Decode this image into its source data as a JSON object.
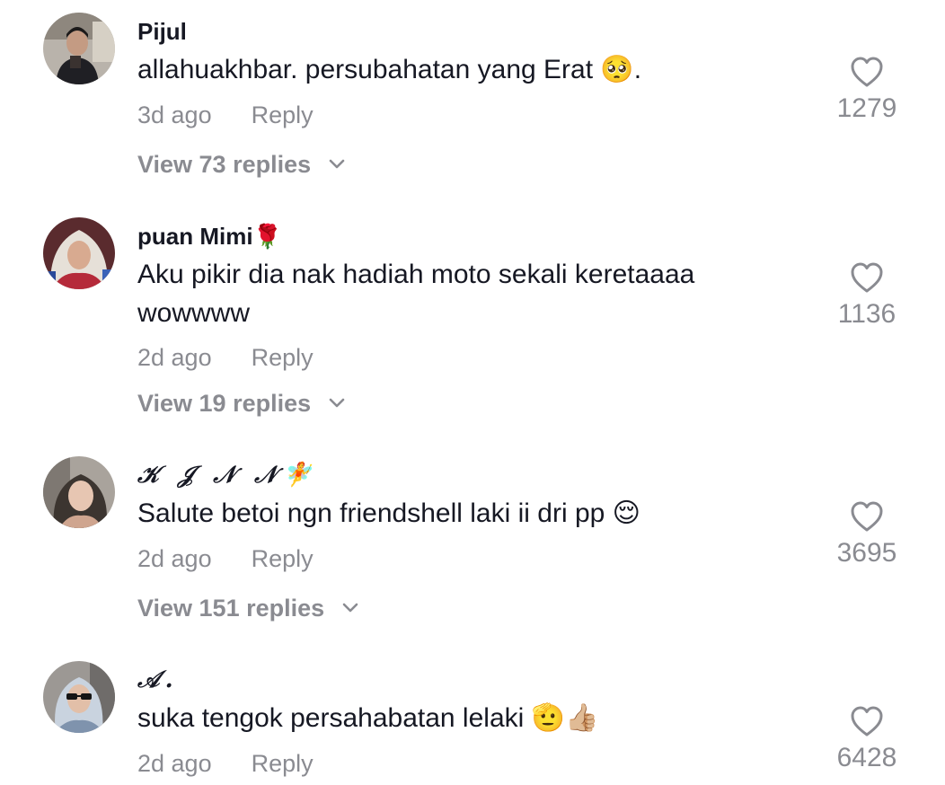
{
  "comments": [
    {
      "username": "Pijul",
      "username_emoji": "",
      "text": "allahuakhbar. persubahatan yang Erat 🥺.",
      "time": "3d ago",
      "reply_label": "Reply",
      "view_replies": "View 73 replies",
      "likes": "1279"
    },
    {
      "username": "puan Mimi",
      "username_emoji": "🌹",
      "text": "Aku pikir dia nak hadiah moto sekali keretaaaa wowwww",
      "time": "2d ago",
      "reply_label": "Reply",
      "view_replies": "View 19 replies",
      "likes": "1136"
    },
    {
      "username": "𝒦 𝒥 𝒩 𝒩",
      "username_emoji": "🧚",
      "text": "Salute betoi ngn friendshell laki ii dri pp 😌",
      "time": "2d ago",
      "reply_label": "Reply",
      "view_replies": "View 151 replies",
      "likes": "3695"
    },
    {
      "username": "𝒜.",
      "username_emoji": "",
      "text": "suka tengok persahabatan lelaki 🫡👍🏼",
      "time": "2d ago",
      "reply_label": "Reply",
      "likes": "6428"
    }
  ],
  "icons": {
    "like": "heart-outline-icon",
    "expand": "chevron-down-icon"
  },
  "colors": {
    "text_primary": "#161823",
    "text_secondary": "#8a8b91"
  }
}
